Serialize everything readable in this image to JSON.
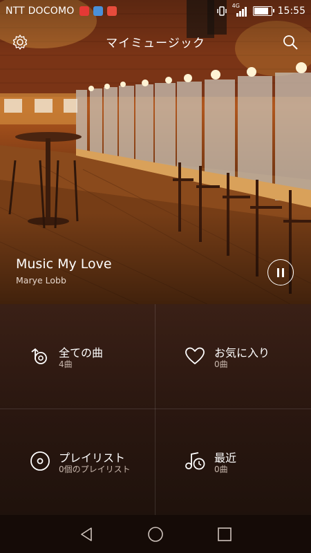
{
  "status_bar": {
    "carrier": "NTT DOCOMO",
    "time": "15:55",
    "network": "4G",
    "app_icon_colors": [
      "#e53935",
      "#4a90d9",
      "#e74c3c"
    ]
  },
  "header": {
    "title": "マイミュージック"
  },
  "now_playing": {
    "title": "Music My Love",
    "artist": "Marye Lobb"
  },
  "library": [
    {
      "label": "全ての曲",
      "sub": "4曲",
      "icon": "shuffle-note-icon"
    },
    {
      "label": "お気に入り",
      "sub": "0曲",
      "icon": "heart-icon"
    },
    {
      "label": "プレイリスト",
      "sub": "0個のプレイリスト",
      "icon": "disc-icon"
    },
    {
      "label": "最近",
      "sub": "0曲",
      "icon": "recent-music-icon"
    }
  ],
  "colors": {
    "accent": "#ffffff",
    "background": "#2a1710"
  }
}
